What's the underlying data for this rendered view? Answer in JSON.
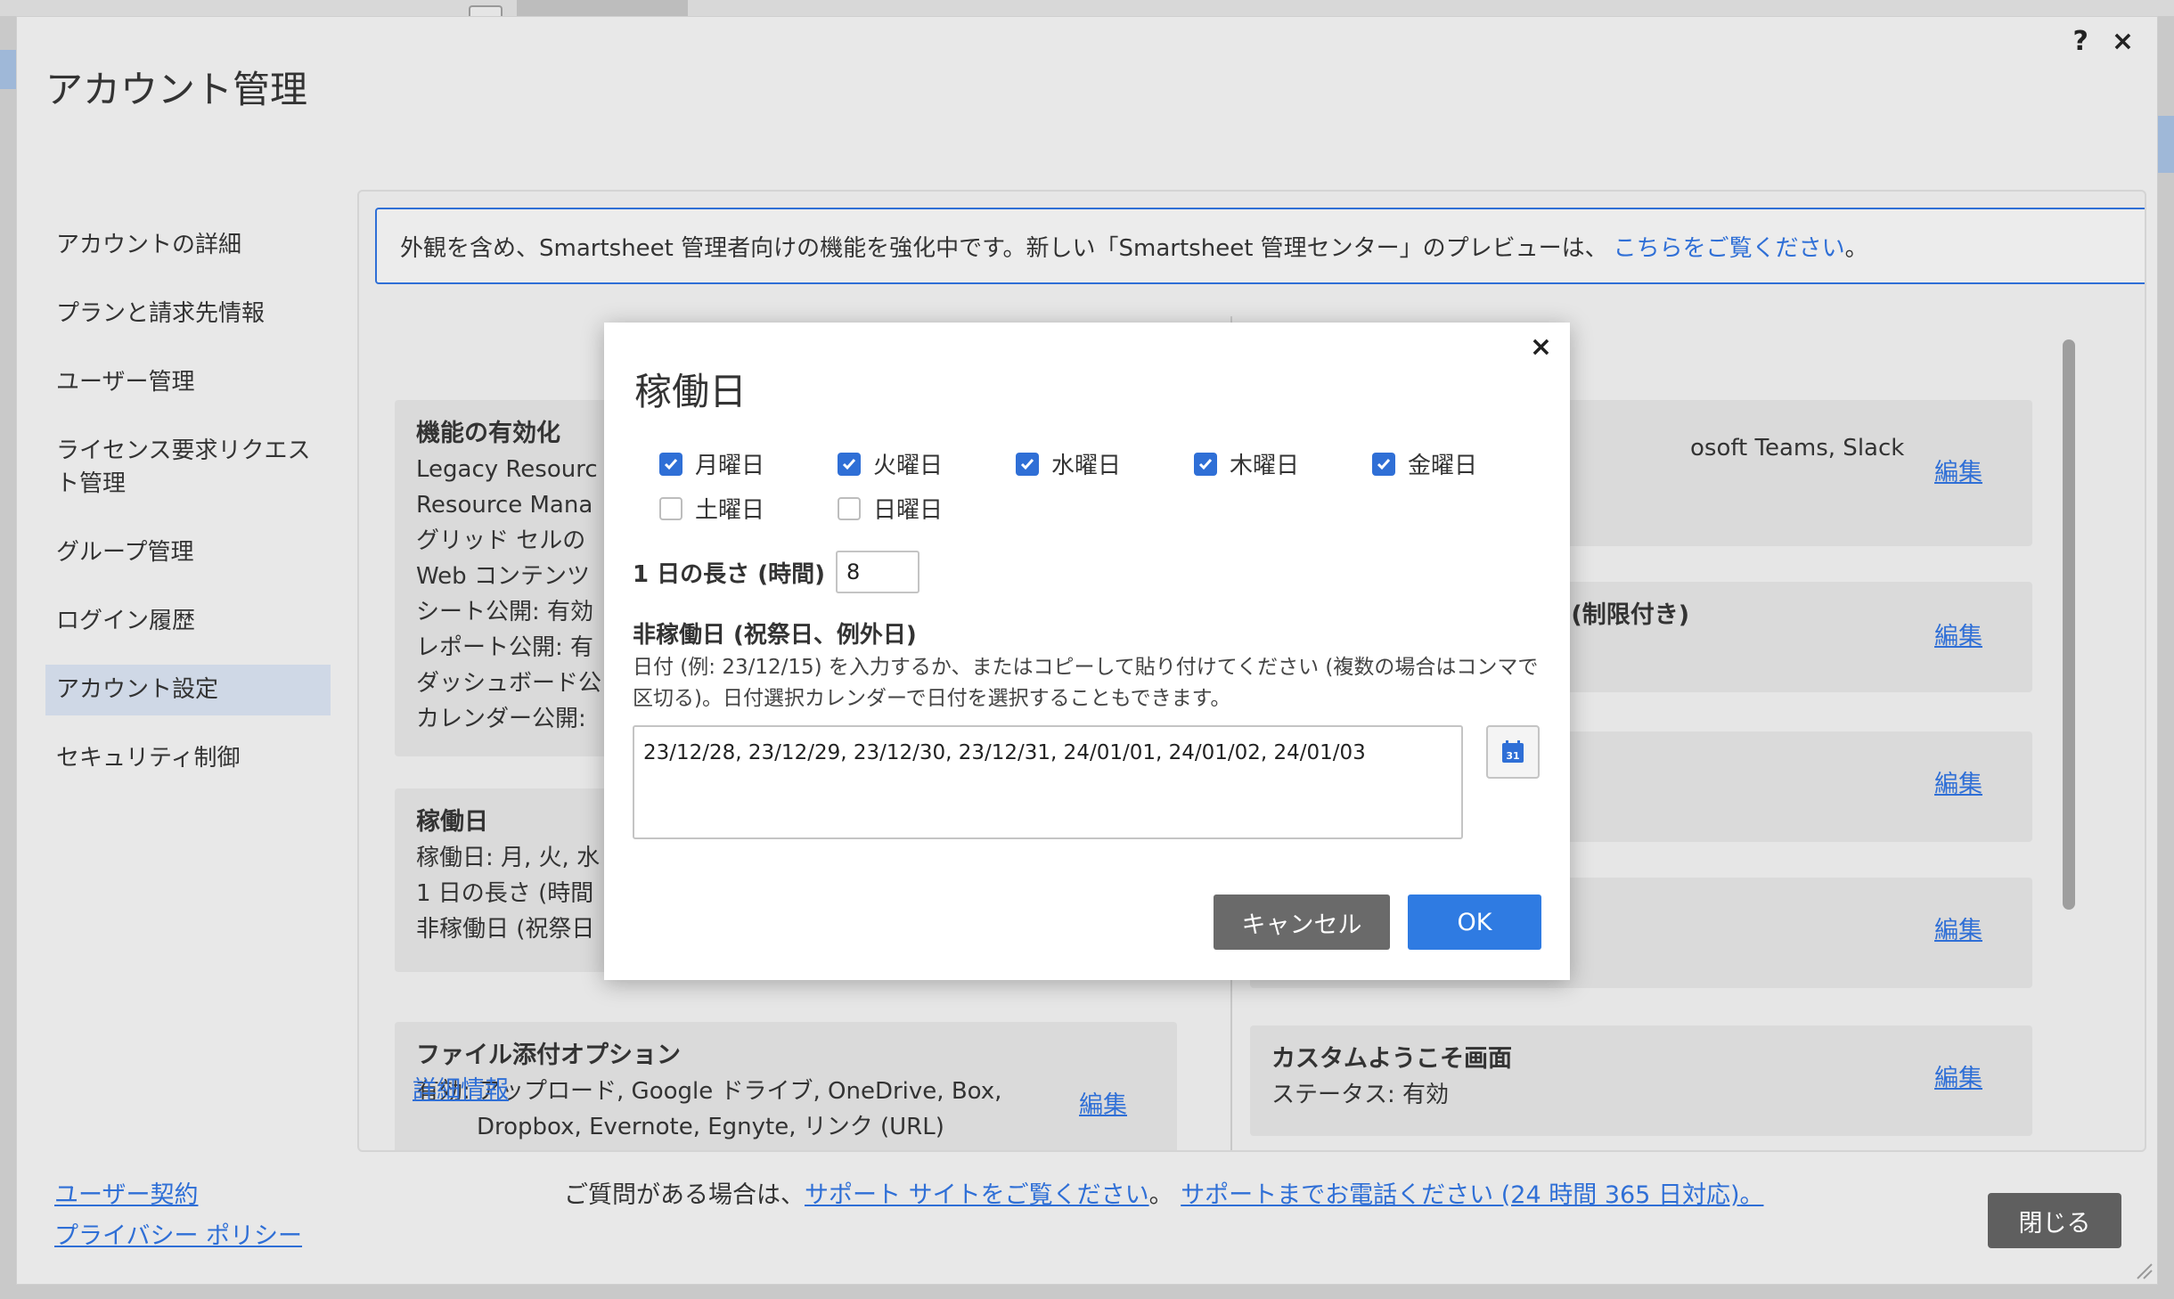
{
  "dialog": {
    "title": "アカウント管理",
    "help_icon": "?",
    "close_icon": "×"
  },
  "nav": {
    "items": [
      {
        "label": "アカウントの詳細"
      },
      {
        "label": "プランと請求先情報"
      },
      {
        "label": "ユーザー管理"
      },
      {
        "label": "ライセンス要求リクエスト管理"
      },
      {
        "label": "グループ管理"
      },
      {
        "label": "ログイン履歴"
      },
      {
        "label": "アカウント設定",
        "active": true
      },
      {
        "label": "セキュリティ制御"
      }
    ]
  },
  "banner": {
    "text": "外観を含め、Smartsheet 管理者向けの機能を強化中です。新しい「Smartsheet 管理センター」のプレビューは、",
    "link": "こちらをご覧ください",
    "suffix": "。"
  },
  "left_cards": {
    "features": {
      "title": "機能の有効化",
      "lines": [
        "Legacy Resourc",
        "Resource Mana",
        "グリッド セルの",
        "Web コンテンツ",
        "シート公開: 有効",
        "レポート公開: 有",
        "ダッシュボード公",
        "カレンダー公開:"
      ]
    },
    "workdays": {
      "title": "稼働日",
      "lines": [
        "稼働日: 月, 火, 水",
        "1 日の長さ (時間",
        "非稼働日 (祝祭日"
      ]
    },
    "attachments": {
      "title": "ファイル添付オプション",
      "lines": [
        "有効: アップロード, Google ドライブ, OneDrive, Box,",
        "Dropbox, Evernote, Egnyte, リンク (URL)"
      ],
      "edit": "編集"
    }
  },
  "right_cards": [
    {
      "lines": [
        "",
        "osoft Teams, Slack"
      ],
      "edit": "編集"
    },
    {
      "title": "グ (制限付き)",
      "edit": "編集"
    },
    {
      "edit": "編集"
    },
    {
      "edit": "編集"
    },
    {
      "title": "カスタムようこそ画面",
      "lines": [
        "ステータス: 有効"
      ],
      "edit": "編集"
    }
  ],
  "details_link": "詳細情報",
  "footer": {
    "user_agreement": "ユーザー契約",
    "privacy_policy": "プライバシー ポリシー",
    "question_text": "ご質問がある場合は、",
    "support_site": "サポート サイトをご覧ください",
    "separator": "。 ",
    "support_phone": "サポートまでお電話ください (24 時間 365 日対応)。",
    "close_button": "閉じる"
  },
  "modal": {
    "title": "稼働日",
    "close_icon": "×",
    "days": [
      {
        "label": "月曜日",
        "checked": true
      },
      {
        "label": "火曜日",
        "checked": true
      },
      {
        "label": "水曜日",
        "checked": true
      },
      {
        "label": "木曜日",
        "checked": true
      },
      {
        "label": "金曜日",
        "checked": true
      },
      {
        "label": "土曜日",
        "checked": false
      },
      {
        "label": "日曜日",
        "checked": false
      }
    ],
    "day_length_label": "1 日の長さ (時間)",
    "day_length_value": "8",
    "holidays_title": "非稼働日 (祝祭日、例外日)",
    "holidays_desc": "日付 (例: 23/12/15) を入力するか、またはコピーして貼り付けてください (複数の場合はコンマで区切る)。日付選択カレンダーで日付を選択することもできます。",
    "holidays_value": "23/12/28, 23/12/29, 23/12/30, 23/12/31, 24/01/01, 24/01/02, 24/01/03",
    "calendar_icon_text": "31",
    "cancel": "キャンセル",
    "ok": "OK",
    "colors": {
      "accent": "#2f7be2",
      "cancel_bg": "#6a6a6a"
    }
  }
}
